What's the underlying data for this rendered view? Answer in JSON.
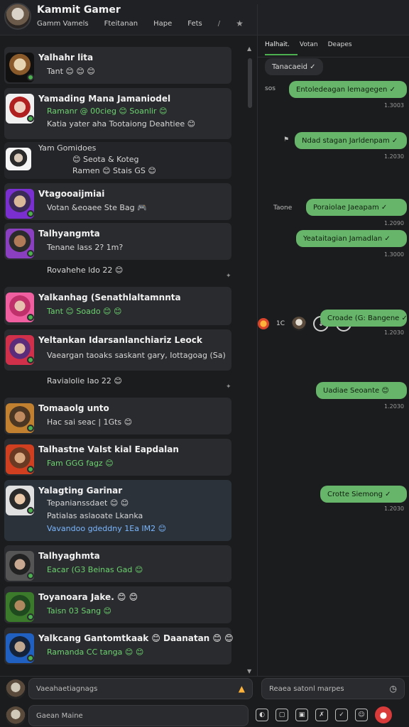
{
  "header": {
    "title": "Kammit Gamer",
    "tabs": [
      "Gamm Vamels",
      "Fteitanan",
      "Hape",
      "Fets"
    ],
    "separator": "/",
    "count": "1C",
    "icons": [
      "avatar",
      "star-icon",
      "fire-icon",
      "download-icon"
    ]
  },
  "chats": [
    {
      "name": "Yalhahr lita",
      "lines": [
        {
          "text": "Tant 😊 😊 😊",
          "color": "white"
        }
      ],
      "avatar_icon": "gamer-avatar-1"
    },
    {
      "name": "Yamading Mana Jamaniodel",
      "lines": [
        {
          "text": "Ramanr @ 00cieg 😊 Soanlir 😊",
          "color": "green"
        },
        {
          "text": "Katia yater aha Tootaiong Deahtiee 😊",
          "color": "white"
        }
      ],
      "sub": [
        {
          "text": "Yam Gomidoes",
          "color": "white"
        },
        {
          "text": "😊 Seota & Koteg",
          "color": "white"
        },
        {
          "text": "Ramen 😊 Stais GS 😊",
          "color": "white"
        }
      ],
      "avatar_icon": "gamer-avatar-2"
    },
    {
      "name": "Vtagooaijmiai",
      "lines": [
        {
          "text": "Votan &eoaee Ste Bag 🎮",
          "color": "white"
        }
      ],
      "avatar_icon": "gamer-avatar-3"
    },
    {
      "name": "Talhyangmta",
      "lines": [
        {
          "text": "Tenane lass 2? 1m?",
          "color": "white"
        }
      ],
      "avatar_icon": "gamer-avatar-4"
    },
    {
      "name": "Yalkanhag (Senathlaltamnnta",
      "lines": [
        {
          "text": "Tant 😊 Soado 😊 😊",
          "color": "green"
        }
      ],
      "avatar_icon": "gamer-avatar-5"
    },
    {
      "name": "Yeltankan Idarsanlanchiariz Leock",
      "lines": [
        {
          "text": "Vaeargan taoaks saskant gary, Iottagoag (Sa)",
          "color": "white"
        }
      ],
      "avatar_icon": "gamer-avatar-6"
    },
    {
      "name": "Tomaaolg unto",
      "lines": [
        {
          "text": "Hac sai seac | 1Gts 😊",
          "color": "white"
        }
      ],
      "avatar_icon": "gamer-avatar-7"
    },
    {
      "name": "Talhastne Valst kial Eapdalan",
      "lines": [
        {
          "text": "Fam GGG fagz 😊",
          "color": "green"
        }
      ],
      "avatar_icon": "gamer-avatar-8"
    },
    {
      "name": "Yalagting Garinar",
      "lines": [
        {
          "text": "Tepanianssdaet 😊 😊",
          "color": "white"
        },
        {
          "text": "Patialas aslaoate Lkanka",
          "color": "white"
        },
        {
          "text": "Vavandoo gdeddny 1Ea IM2 😊",
          "color": "blue"
        }
      ],
      "avatar_icon": "gamer-avatar-9"
    },
    {
      "name": "Talhyaghmta",
      "lines": [
        {
          "text": "Eacar (G3 Beinas Gad 😊",
          "color": "green"
        }
      ],
      "avatar_icon": "gamer-avatar-10"
    },
    {
      "name": "Toyanoara Jake. 😊 😊",
      "lines": [
        {
          "text": "Taisn 03 Sang 😊",
          "color": "green"
        }
      ],
      "avatar_icon": "gamer-avatar-11"
    },
    {
      "name": "Yalkcang Gantomtkaak 😊 Daanatan 😊 😊",
      "lines": [
        {
          "text": "Ramanda CC tanga 😊 😊",
          "color": "green"
        }
      ],
      "avatar_icon": "gamer-avatar-12"
    }
  ],
  "subtexts": [
    {
      "text": "Rovahehe ldo 22 😊",
      "color": "white"
    },
    {
      "text": "Ravialolie Iao 22 😊",
      "color": "white"
    }
  ],
  "right_panel": {
    "tabs": [
      "Halhait.",
      "Votan",
      "Deapes"
    ],
    "top_bubble": "Tanacaeid ✓",
    "messages": [
      {
        "text": "Entoledeagan lemagegen ✓",
        "time": "1.3003",
        "left_label": "sos"
      },
      {
        "text": "Ndad stagan Jarldenpam ✓",
        "time": "1.2030",
        "left_label": "⚑"
      },
      {
        "text": "Poraiolae Jaeapam ✓",
        "time": "1.2090",
        "left_label": "Taone"
      },
      {
        "text": "Yeataitagian Jamadlan ✓",
        "time": "1.3000"
      },
      {
        "text": "Croade (G: Bangene ✓",
        "time": "1.2030"
      },
      {
        "text": "Uadiae Seoante 😊",
        "time": "1.2030"
      },
      {
        "text": "Crotte Siemong ✓",
        "time": "1.2030"
      }
    ]
  },
  "bottom": {
    "left_input_placeholder": "Vaeahaetiagnags",
    "right_input_placeholder": "Reaea satonl marpes",
    "message_input_placeholder": "Gaean Maine",
    "toolbar_icons": [
      "theme-icon",
      "square-icon",
      "image-icon",
      "vote-icon",
      "check-icon",
      "emoji-icon",
      "record-icon"
    ]
  }
}
